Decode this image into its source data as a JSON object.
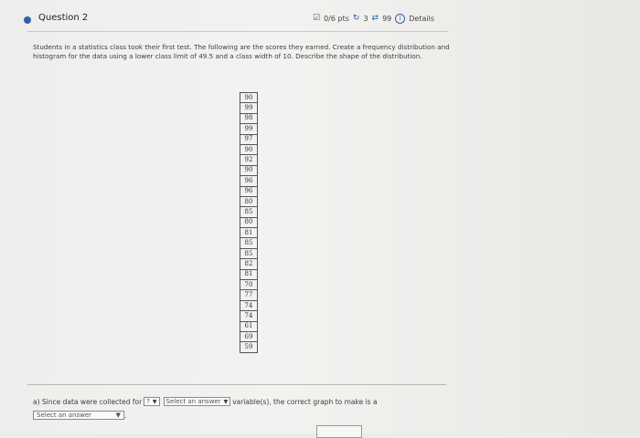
{
  "question": {
    "title": "Question 2",
    "points": "0/6 pts",
    "retries": "3",
    "attempts": "99",
    "details": "Details"
  },
  "problem": {
    "text": "Students in a statistics class took their first test. The following are the scores they earned. Create a frequency distribution and histogram for the data using a lower class limit of 49.5 and a class width of 10. Describe the shape of the distribution."
  },
  "scores": [
    "90",
    "99",
    "98",
    "99",
    "97",
    "90",
    "92",
    "90",
    "96",
    "96",
    "80",
    "85",
    "80",
    "81",
    "85",
    "85",
    "82",
    "81",
    "70",
    "77",
    "74",
    "74",
    "61",
    "69",
    "59"
  ],
  "answer": {
    "part_a_prefix": "a) Since data were collected for",
    "select1_value": "?",
    "select2_value": "Select an answer",
    "part_a_suffix": "variable(s), the correct graph to make is a",
    "select3_value": "Select an answer",
    "end_punct": "."
  },
  "icons": {
    "points_icon": "edit-square-icon",
    "retry_icon": "retry-icon",
    "attempts_icon": "cycle-icon",
    "info_icon": "info-circle-icon"
  },
  "colors": {
    "accent": "#2d5fa6",
    "question_dot": "#2f5fb0"
  }
}
